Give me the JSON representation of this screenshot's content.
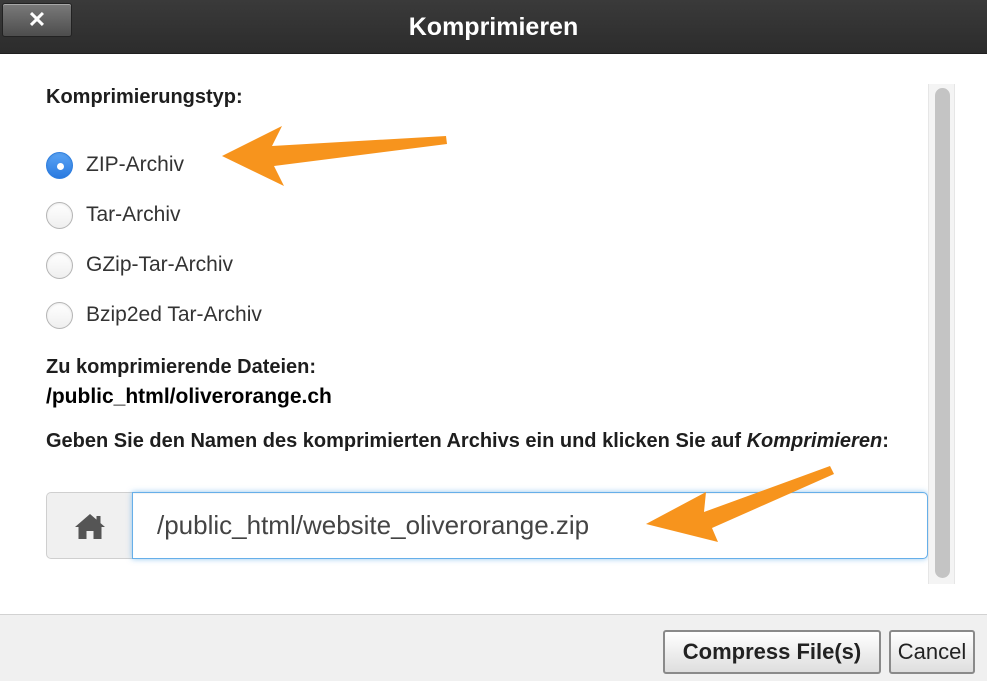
{
  "dialog": {
    "title": "Komprimieren",
    "close_label": "✕"
  },
  "compression": {
    "heading": "Komprimierungstyp:",
    "options": [
      {
        "label": "ZIP-Archiv",
        "selected": true
      },
      {
        "label": "Tar-Archiv",
        "selected": false
      },
      {
        "label": "GZip-Tar-Archiv",
        "selected": false
      },
      {
        "label": "Bzip2ed Tar-Archiv",
        "selected": false
      }
    ]
  },
  "files": {
    "heading": "Zu komprimierende Dateien:",
    "path": "/public_html/oliverorange.ch"
  },
  "instruction": {
    "text": "Geben Sie den Namen des komprimierten Archivs ein und klicken Sie auf ",
    "emphasis": "Komprimieren",
    "suffix": ":"
  },
  "archive_input": {
    "value": "/public_html/website_oliverorange.zip",
    "addon_icon": "home-icon"
  },
  "footer": {
    "compress_label": "Compress File(s)",
    "cancel_label": "Cancel"
  },
  "colors": {
    "titlebar": "#2c2c2c",
    "radio_selected": "#2a7ae0",
    "input_focus": "#66afe9",
    "annotation_arrow": "#f7941d"
  }
}
